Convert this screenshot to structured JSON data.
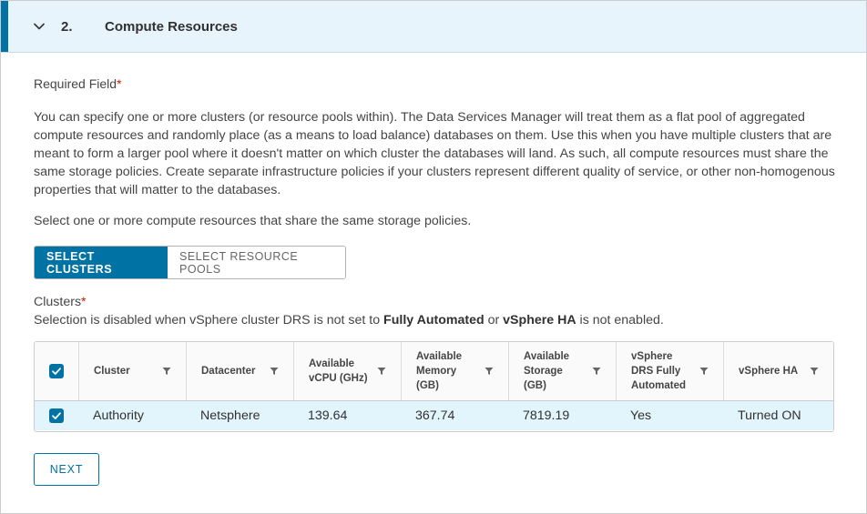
{
  "step": {
    "number": "2.",
    "title": "Compute Resources"
  },
  "required_field": {
    "label": "Required Field",
    "star": "*"
  },
  "description": "You can specify one or more clusters (or resource pools within). The Data Services Manager will treat them as a flat pool of aggregated compute resources and randomly place (as a means to load balance) databases on them. Use this when you have multiple clusters that are meant to form a larger pool where it doesn't matter on which cluster the databases will land. As such, all compute resources must share the same storage policies. Create separate infrastructure policies if your clusters represent different quality of service, or other non-homogenous properties that will matter to the databases.",
  "select_instruction": "Select one or more compute resources that share the same storage policies.",
  "toggle": {
    "clusters_label": "SELECT CLUSTERS",
    "pools_label": "SELECT RESOURCE POOLS",
    "selected": "clusters"
  },
  "clusters_field": {
    "label": "Clusters",
    "star": "*",
    "info_prefix": "Selection is disabled when vSphere cluster DRS is not set to ",
    "info_bold1": "Fully Automated",
    "info_mid": " or ",
    "info_bold2": "vSphere HA",
    "info_suffix": " is not enabled."
  },
  "table": {
    "columns": [
      "Cluster",
      "Datacenter",
      "Available vCPU (GHz)",
      "Available Memory (GB)",
      "Available Storage (GB)",
      "vSphere DRS Fully Automated",
      "vSphere HA"
    ],
    "rows": [
      {
        "selected": true,
        "cluster": "Authority",
        "datacenter": "Netsphere",
        "vcpu": "139.64",
        "memory": "367.74",
        "storage": "7819.19",
        "drs": "Yes",
        "ha": "Turned ON"
      }
    ],
    "all_selected": true
  },
  "next_label": "NEXT",
  "colors": {
    "accent": "#0072a3",
    "header_bg": "#e8f4fb",
    "selected_row_bg": "#e3f5fc",
    "required_star": "#c21d00"
  }
}
